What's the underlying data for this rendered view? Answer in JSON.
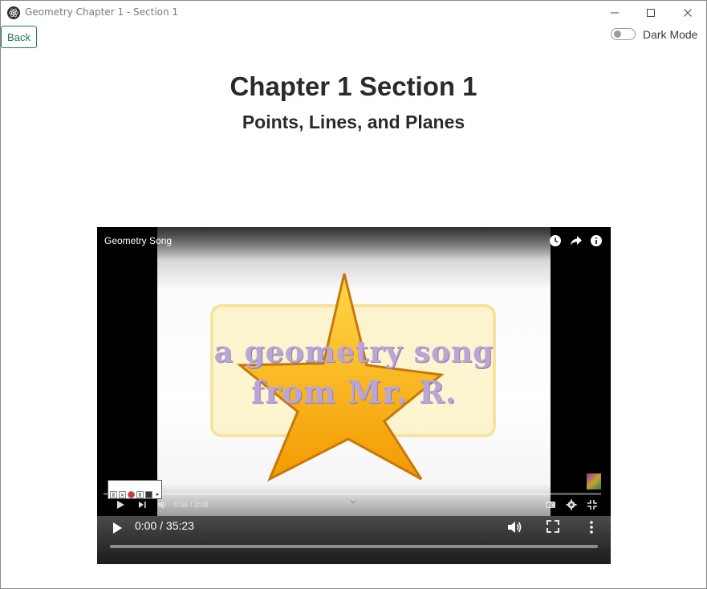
{
  "window": {
    "title": "Geometry Chapter 1 - Section 1",
    "icons": [
      "app-icon",
      "minimize-icon",
      "maximize-icon",
      "close-icon"
    ]
  },
  "header": {
    "back_label": "Back",
    "dark_mode_label": "Dark Mode",
    "dark_mode_on": false
  },
  "page": {
    "title": "Chapter 1 Section 1",
    "subtitle": "Points, Lines, and Planes"
  },
  "video": {
    "embed_title": "Geometry Song",
    "card_line_1": "a geometry song",
    "card_line_2": "from Mr. R.",
    "embed_time": "0:06 / 3:08",
    "player_time": "0:00 / 35:23",
    "top_icons": [
      "watch-later-icon",
      "share-icon",
      "info-icon"
    ],
    "bottom_icons": [
      "play-icon",
      "next-icon",
      "volume-icon",
      "captions-icon",
      "settings-icon",
      "exit-fullscreen-icon"
    ],
    "player_icons": [
      "play-icon",
      "volume-icon",
      "fullscreen-icon",
      "more-options-icon"
    ]
  },
  "colors": {
    "accent": "#1e7a55",
    "star": "#f5b400",
    "card_text": "#b9a6d6"
  }
}
